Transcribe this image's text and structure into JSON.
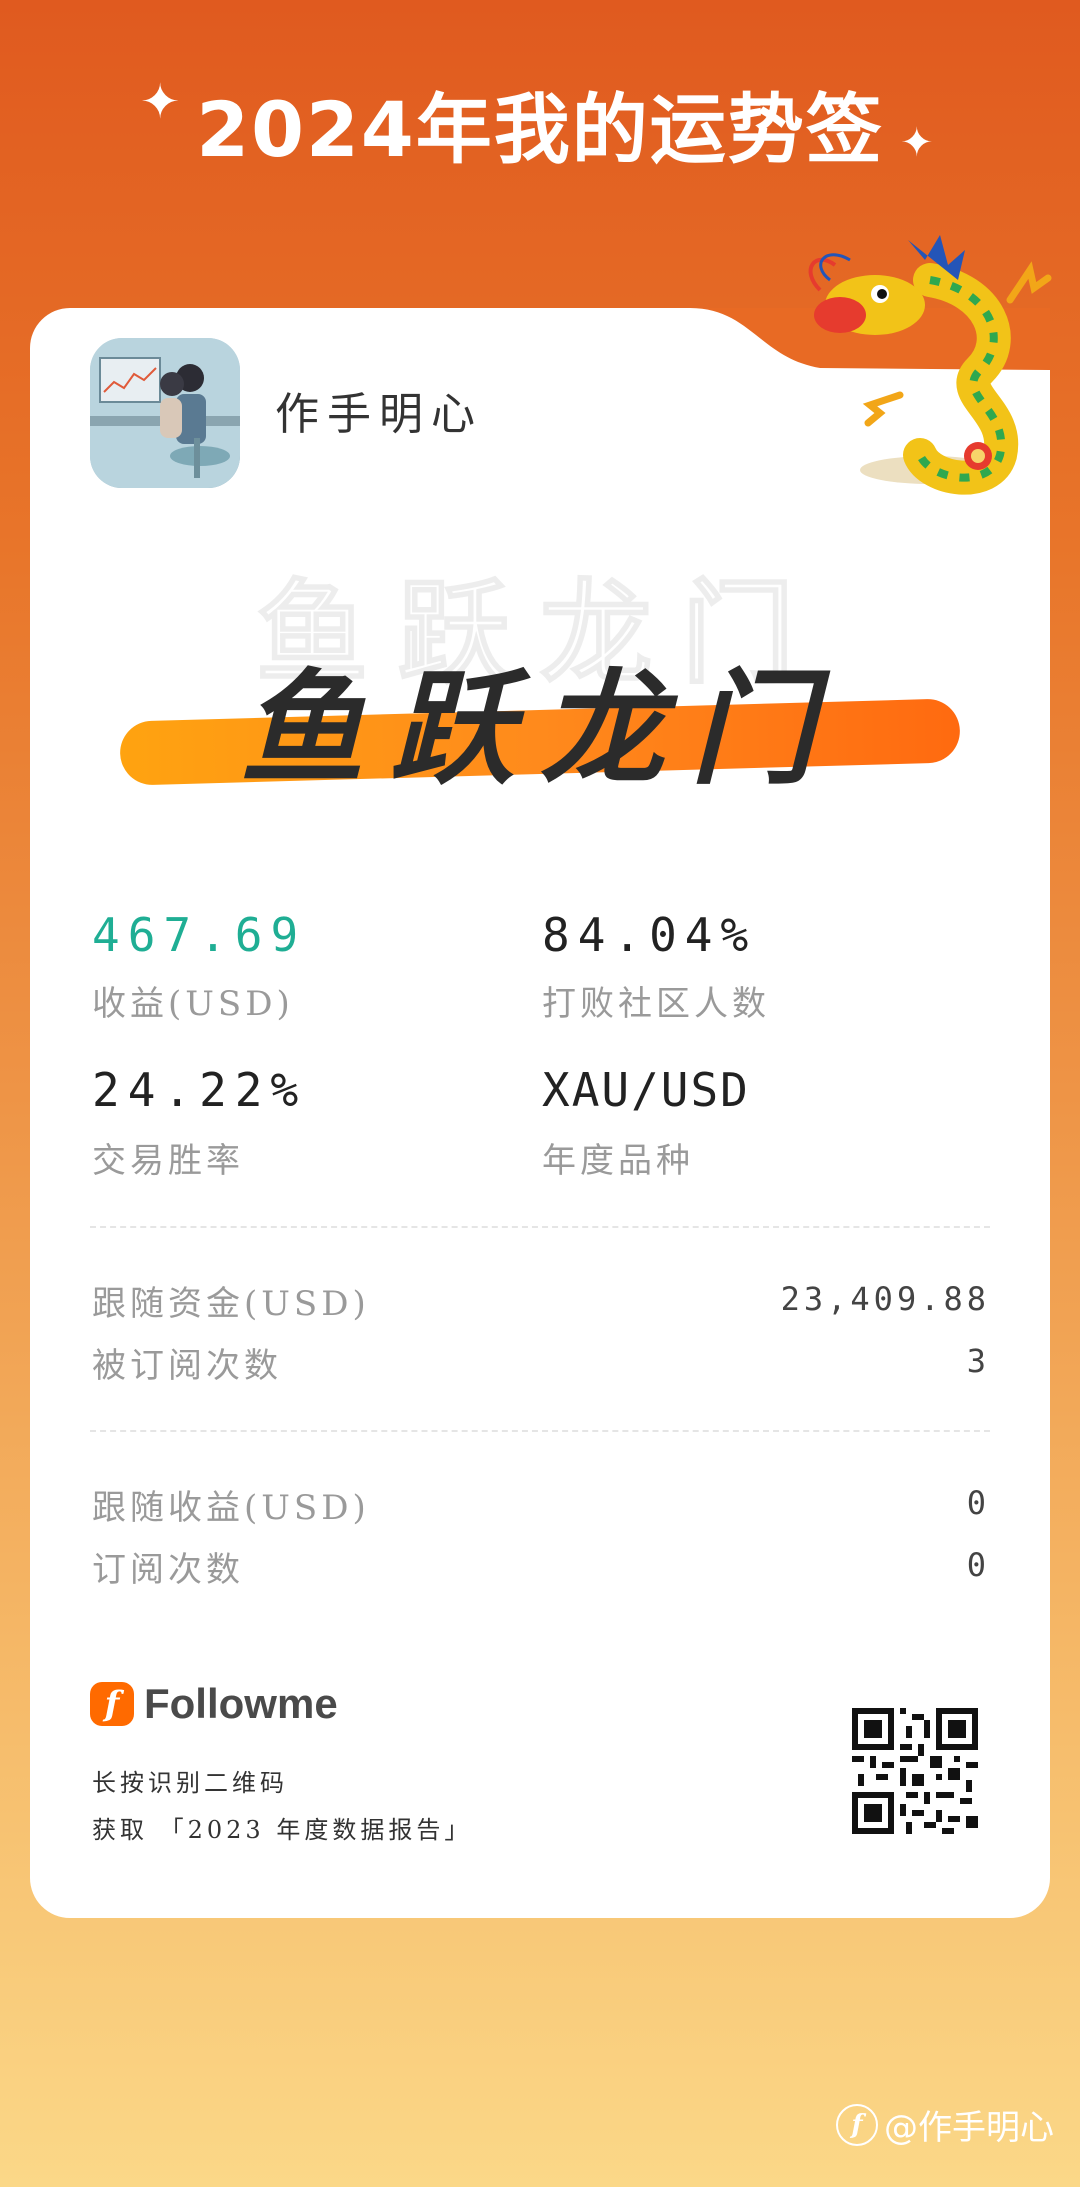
{
  "header": {
    "title": "2024年我的运势签"
  },
  "profile": {
    "username": "作手明心"
  },
  "slogan": {
    "text": "鱼跃龙门"
  },
  "stats": [
    {
      "value": "467.69",
      "label": "收益(USD)"
    },
    {
      "value": "84.04%",
      "label": "打败社区人数"
    },
    {
      "value": "24.22%",
      "label": "交易胜率"
    },
    {
      "value": "XAU/USD",
      "label": "年度品种"
    }
  ],
  "follow": [
    {
      "label": "跟随资金(USD)",
      "value": "23,409.88"
    },
    {
      "label": "被订阅次数",
      "value": "3"
    }
  ],
  "follow_income": [
    {
      "label": "跟随收益(USD)",
      "value": "0"
    },
    {
      "label": "订阅次数",
      "value": "0"
    }
  ],
  "footer": {
    "brand": "Followme",
    "brand_icon": "f",
    "line1": "长按识别二维码",
    "line2": "获取 「2023 年度数据报告」"
  },
  "watermark": {
    "icon": "f",
    "text": "@作手明心"
  },
  "colors": {
    "accent": "#ff8a1c",
    "positive": "#1fae94",
    "brand": "#ff6a00"
  },
  "icons": [
    "sparkle-icon",
    "dragon-illustration",
    "followme-logo-icon",
    "qr-code"
  ]
}
